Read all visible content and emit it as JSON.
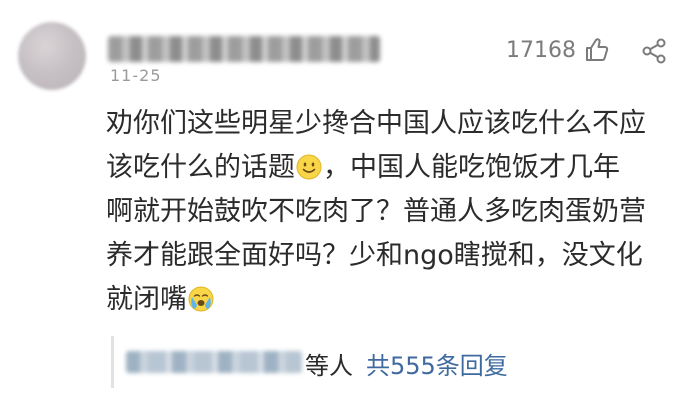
{
  "comment": {
    "date": "11-25",
    "likes": "17168",
    "lines": [
      "劝你们这些明星少搀合中国人应该吃什么不应",
      "该吃什么的话题",
      "，中国人能吃饱饭才几年",
      "啊就开始鼓吹不吃肉了？普通人多吃肉蛋奶营",
      "养才能跟全面好吗？少和ngo瞎搅和，没文化",
      "就闭嘴"
    ],
    "emoji_1": "smiling-face-emoji",
    "emoji_2": "crying-face-emoji"
  },
  "replies": {
    "etc_label": "等人",
    "count_label": "共555条回复"
  },
  "icons": {
    "like": "thumbs-up-icon",
    "share": "share-icon"
  },
  "colors": {
    "text": "#2b2b2b",
    "meta": "#9a9a9a",
    "link": "#3f6aa0"
  }
}
